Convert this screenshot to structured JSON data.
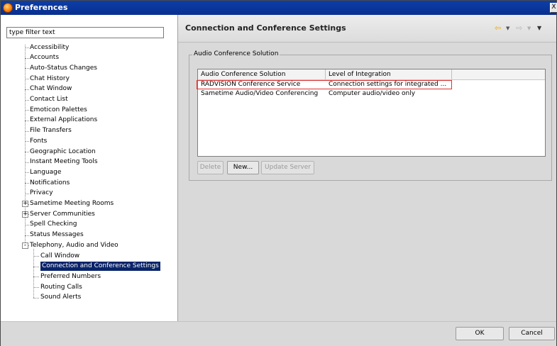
{
  "window": {
    "title": "Preferences",
    "close_label": "X"
  },
  "filter": {
    "placeholder": "type filter text",
    "value": "type filter text"
  },
  "tree": {
    "items": [
      {
        "label": "Accessibility"
      },
      {
        "label": "Accounts"
      },
      {
        "label": "Auto-Status Changes"
      },
      {
        "label": "Chat History"
      },
      {
        "label": "Chat Window"
      },
      {
        "label": "Contact List"
      },
      {
        "label": "Emoticon Palettes"
      },
      {
        "label": "External Applications"
      },
      {
        "label": "File Transfers"
      },
      {
        "label": "Fonts"
      },
      {
        "label": "Geographic Location"
      },
      {
        "label": "Instant Meeting Tools"
      },
      {
        "label": "Language"
      },
      {
        "label": "Notifications"
      },
      {
        "label": "Privacy"
      },
      {
        "label": "Sametime Meeting Rooms",
        "expander": "+"
      },
      {
        "label": "Server Communities",
        "expander": "+"
      },
      {
        "label": "Spell Checking"
      },
      {
        "label": "Status Messages"
      },
      {
        "label": "Telephony, Audio and Video",
        "expander": "-"
      }
    ],
    "children": [
      {
        "label": "Call Window"
      },
      {
        "label": "Connection and Conference Settings",
        "selected": true
      },
      {
        "label": "Preferred Numbers"
      },
      {
        "label": "Routing Calls"
      },
      {
        "label": "Sound Alerts"
      }
    ]
  },
  "page": {
    "title": "Connection and Conference Settings",
    "nav": {
      "back_icon": "back-arrow-icon",
      "forward_icon": "forward-arrow-icon",
      "menu_icon": "menu-triangle-icon"
    }
  },
  "group": {
    "legend": "Audio Conference Solution",
    "table": {
      "columns": [
        "Audio Conference Solution",
        "Level of Integration"
      ],
      "rows": [
        {
          "solution": "RADVISION Conference Service",
          "integration": "Connection settings for integrated ...",
          "highlighted": true
        },
        {
          "solution": "Sametime Audio/Video Conferencing",
          "integration": "Computer audio/video only"
        }
      ]
    },
    "buttons": {
      "delete": "Delete",
      "new": "New...",
      "update": "Update Server"
    }
  },
  "footer": {
    "ok": "OK",
    "cancel": "Cancel"
  },
  "colors": {
    "titlebar": "#0a2f8f",
    "selection": "#0a246a",
    "highlight_border": "#e03030",
    "nav_arrow": "#f0a800"
  }
}
